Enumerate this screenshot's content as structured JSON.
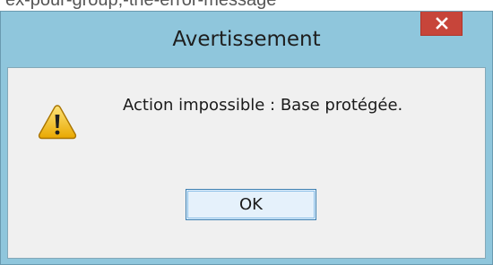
{
  "caption": {
    "text": "ex-pour-group,-the-error-message"
  },
  "dialog": {
    "title": "Avertissement",
    "message": "Action impossible : Base protégée.",
    "ok_label": "OK",
    "close_icon": "close-icon",
    "warning_icon": "warning-icon"
  },
  "colors": {
    "frame": "#8fc6dc",
    "close_button": "#c7453a",
    "client_bg": "#f0f0f0",
    "ok_border": "#3c7fb1",
    "ok_bg": "#e5f1fb",
    "warning_fill": "#f5c518"
  }
}
